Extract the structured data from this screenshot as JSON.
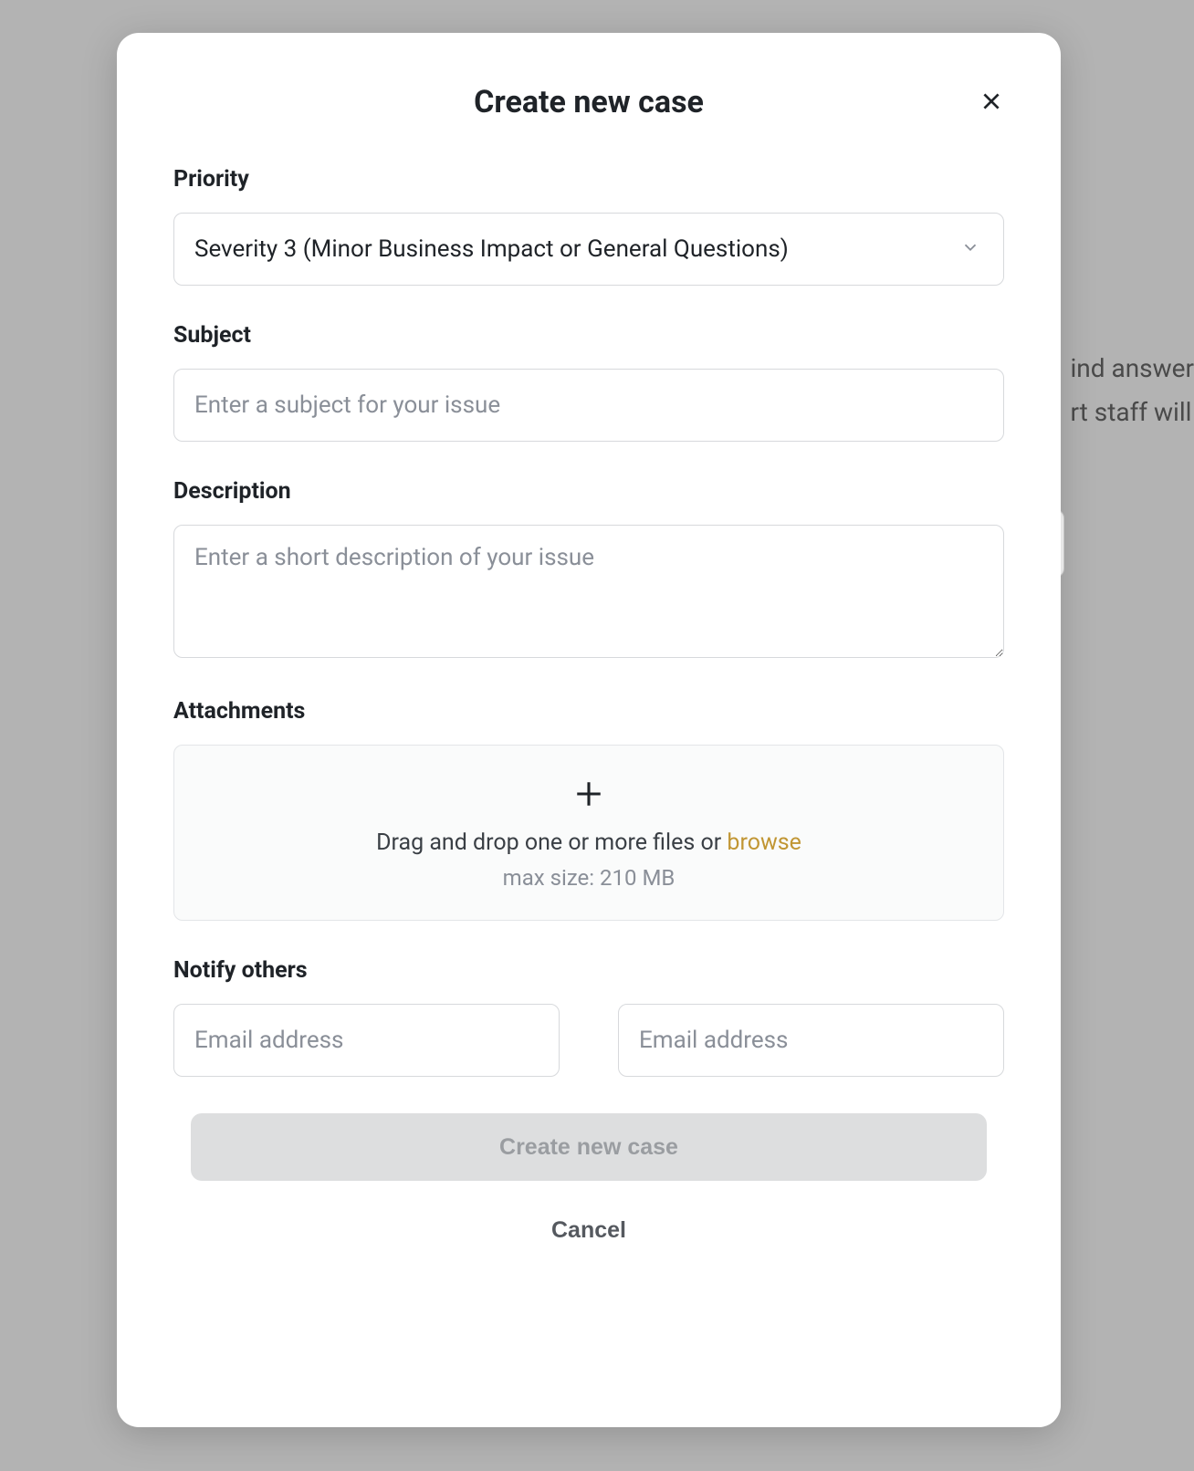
{
  "background": {
    "line1": "ind answer",
    "line2": "rt staff will"
  },
  "modal": {
    "title": "Create new case",
    "priority": {
      "label": "Priority",
      "selected": "Severity 3 (Minor Business Impact or General Questions)"
    },
    "subject": {
      "label": "Subject",
      "placeholder": "Enter a subject for your issue",
      "value": ""
    },
    "description": {
      "label": "Description",
      "placeholder": "Enter a short description of your issue",
      "value": ""
    },
    "attachments": {
      "label": "Attachments",
      "drop_prefix": "Drag and drop one or more files or ",
      "browse": "browse",
      "max_size": "max size: 210 MB"
    },
    "notify": {
      "label": "Notify others",
      "email1_placeholder": "Email address",
      "email1_value": "",
      "email2_placeholder": "Email address",
      "email2_value": ""
    },
    "actions": {
      "submit": "Create new case",
      "cancel": "Cancel"
    }
  }
}
